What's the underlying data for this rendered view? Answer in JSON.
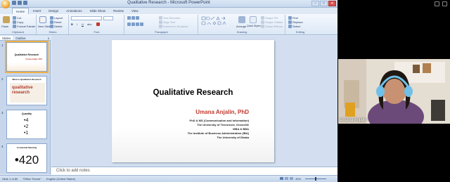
{
  "window": {
    "title": "Qualitative Research - Microsoft PowerPoint",
    "controls": [
      "–",
      "□",
      "✕"
    ]
  },
  "ribbon": {
    "tabs": [
      "Home",
      "Insert",
      "Design",
      "Animations",
      "Slide Show",
      "Review",
      "View"
    ],
    "active_tab": "Home",
    "groups": {
      "clipboard": {
        "label": "Clipboard",
        "paste": "Paste",
        "cut": "Cut",
        "copy": "Copy",
        "format_painter": "Format Painter"
      },
      "slides": {
        "label": "Slides",
        "new_slide": "New Slide",
        "layout": "Layout",
        "reset": "Reset",
        "delete": "Delete"
      },
      "font": {
        "label": "Font"
      },
      "paragraph": {
        "label": "Paragraph",
        "text_direction": "Text Direction",
        "align_text": "Align Text",
        "convert": "Convert to SmartArt"
      },
      "drawing": {
        "label": "Drawing",
        "arrange": "Arrange",
        "quick_styles": "Quick Styles",
        "shape_fill": "Shape Fill",
        "shape_outline": "Shape Outline",
        "shape_effects": "Shape Effects"
      },
      "editing": {
        "label": "Editing",
        "find": "Find",
        "replace": "Replace",
        "select": "Select"
      }
    }
  },
  "left_pane": {
    "tabs": [
      "Slides",
      "Outline"
    ],
    "active_tab": "Slides",
    "close": "x",
    "thumbnails": [
      {
        "num": "1",
        "title": "Qualitative Research",
        "author": "Umana Anjalin, PhD"
      },
      {
        "num": "2",
        "title": "What is Qualitative Research",
        "word_art": "qualitative research"
      },
      {
        "num": "3",
        "title": "Quantity",
        "bullets": [
          "•4",
          "•2",
          "•1"
        ]
      },
      {
        "num": "4",
        "title": "Contextual Meaning",
        "big": "•420"
      }
    ]
  },
  "slide": {
    "title": "Qualitative Research",
    "author": "Umana Anjalin, PhD",
    "lines": [
      "PhD & MS (Communication and Information)",
      "The University of Tennessee, Knoxville",
      "MBA & BBA",
      "The Institute of Business Administration (IBA)",
      "The University of Dhaka"
    ]
  },
  "notes_placeholder": "Click to add notes",
  "status_bar": {
    "slide_info": "Slide 1 of 89",
    "theme": "\"Office Theme\"",
    "language": "English (United States)",
    "zoom": "49%",
    "zoom_level": 0.5
  },
  "webcam": {
    "name": "Umana Anjalin"
  },
  "colors": {
    "accent_author": "#c0392b",
    "ribbon_bg": "#dce8f6",
    "selected_outline": "#f0b040"
  }
}
